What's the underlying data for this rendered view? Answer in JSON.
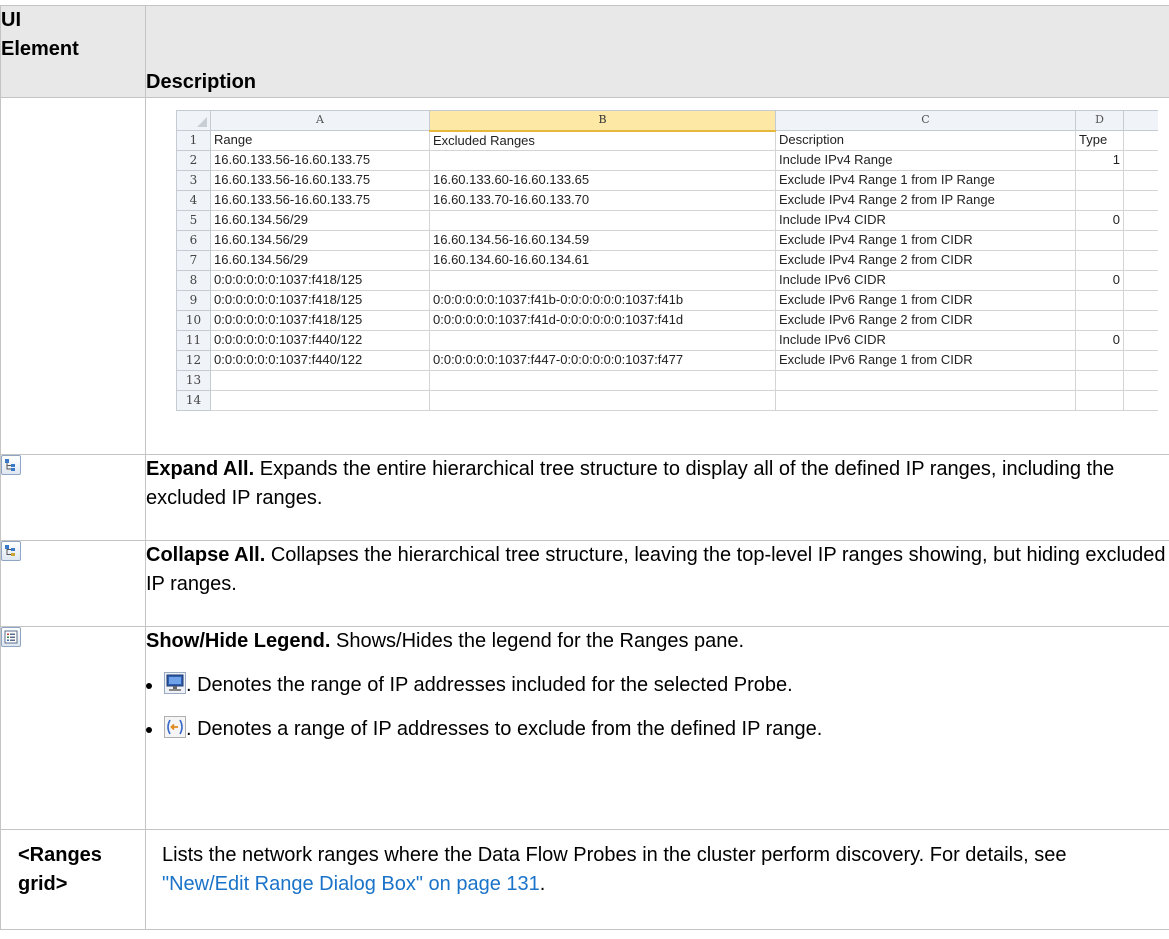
{
  "header": {
    "ui_element_line1": "UI",
    "ui_element_line2": "Element",
    "description": "Description"
  },
  "sheet": {
    "col_headers": [
      "A",
      "B",
      "C",
      "D"
    ],
    "rows": [
      {
        "n": "1",
        "a": "Range",
        "b": "Excluded Ranges",
        "c": "Description",
        "d": "Type"
      },
      {
        "n": "2",
        "a": "16.60.133.56-16.60.133.75",
        "b": "",
        "c": "Include IPv4 Range",
        "d": "1"
      },
      {
        "n": "3",
        "a": "16.60.133.56-16.60.133.75",
        "b": "16.60.133.60-16.60.133.65",
        "c": "Exclude IPv4 Range 1 from IP Range",
        "d": ""
      },
      {
        "n": "4",
        "a": "16.60.133.56-16.60.133.75",
        "b": "16.60.133.70-16.60.133.70",
        "c": "Exclude IPv4 Range 2 from IP Range",
        "d": ""
      },
      {
        "n": "5",
        "a": "16.60.134.56/29",
        "b": "",
        "c": "Include IPv4 CIDR",
        "d": "0"
      },
      {
        "n": "6",
        "a": "16.60.134.56/29",
        "b": "16.60.134.56-16.60.134.59",
        "c": "Exclude IPv4 Range 1 from CIDR",
        "d": ""
      },
      {
        "n": "7",
        "a": "16.60.134.56/29",
        "b": "16.60.134.60-16.60.134.61",
        "c": "Exclude IPv4 Range 2 from CIDR",
        "d": ""
      },
      {
        "n": "8",
        "a": "0:0:0:0:0:0:1037:f418/125",
        "b": "",
        "c": "Include IPv6 CIDR",
        "d": "0"
      },
      {
        "n": "9",
        "a": "0:0:0:0:0:0:1037:f418/125",
        "b": "0:0:0:0:0:0:1037:f41b-0:0:0:0:0:0:1037:f41b",
        "c": "Exclude IPv6 Range 1 from CIDR",
        "d": ""
      },
      {
        "n": "10",
        "a": "0:0:0:0:0:0:1037:f418/125",
        "b": "0:0:0:0:0:0:1037:f41d-0:0:0:0:0:0:1037:f41d",
        "c": "Exclude IPv6 Range 2 from CIDR",
        "d": ""
      },
      {
        "n": "11",
        "a": "0:0:0:0:0:0:1037:f440/122",
        "b": "",
        "c": "Include IPv6 CIDR",
        "d": "0"
      },
      {
        "n": "12",
        "a": "0:0:0:0:0:0:1037:f440/122",
        "b": "0:0:0:0:0:0:1037:f447-0:0:0:0:0:0:1037:f477",
        "c": "Exclude IPv6 Range 1 from CIDR",
        "d": ""
      },
      {
        "n": "13",
        "a": "",
        "b": "",
        "c": "",
        "d": ""
      },
      {
        "n": "14",
        "a": "",
        "b": "",
        "c": "",
        "d": ""
      }
    ]
  },
  "expand": {
    "icon": "expand-all-icon",
    "title": "Expand All.",
    "text": " Expands the entire hierarchical tree structure to display all of the defined IP ranges, including the excluded IP ranges."
  },
  "collapse": {
    "icon": "collapse-all-icon",
    "title": "Collapse All.",
    "text": " Collapses the hierarchical tree structure, leaving the top-level IP ranges showing, but hiding excluded IP ranges."
  },
  "legend": {
    "icon": "legend-icon",
    "title": "Show/Hide Legend.",
    "text": " Shows/Hides the legend for the Ranges pane.",
    "bullets": [
      {
        "icon": "probe-monitor-icon",
        "text": ". Denotes the range of IP addresses included for the selected Probe."
      },
      {
        "icon": "exclude-range-icon",
        "text": ". Denotes a range of IP addresses to exclude from the defined IP range."
      }
    ]
  },
  "ranges_grid": {
    "label_line1": "<Ranges",
    "label_line2": "grid>",
    "text": "Lists the network ranges where the Data Flow Probes in the cluster perform discovery. For details, see ",
    "link": "\"New/Edit Range Dialog Box\" on page 131",
    "end": "."
  }
}
